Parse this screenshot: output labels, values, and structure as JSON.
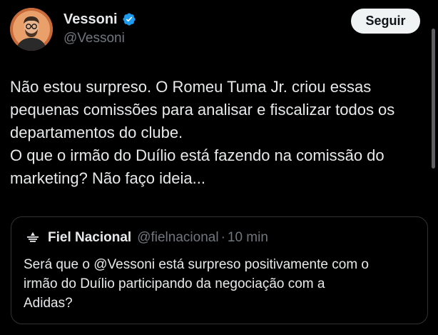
{
  "author": {
    "display_name": "Vessoni",
    "handle": "@Vessoni",
    "verified_icon": "verified-badge-icon",
    "verified_color": "#1d9bf0"
  },
  "follow_button": {
    "label": "Seguir"
  },
  "tweet": {
    "lines": [
      "Não estou surpreso. O Romeu Tuma Jr. criou essas",
      "pequenas comissões para analisar e fiscalizar todos os",
      "departamentos do clube.",
      "O que o irmão do Duílio está fazendo na comissão do",
      "marketing? Não faço ideia..."
    ]
  },
  "quoted_tweet": {
    "display_name": "Fiel Nacional",
    "handle": "@fielnacional",
    "separator": "·",
    "time": "10 min",
    "avatar_icon": "fiel-nacional-logo-icon",
    "lines": [
      "Será que o @Vessoni está surpreso positivamente com o",
      "irmão do Duílio participando da negociação com a",
      "Adidas?"
    ]
  },
  "colors": {
    "background": "#000000",
    "text_primary": "#e7e9ea",
    "text_secondary": "#71767b",
    "border": "#2f3336",
    "button_bg": "#eff3f4",
    "button_text": "#0f1419"
  }
}
